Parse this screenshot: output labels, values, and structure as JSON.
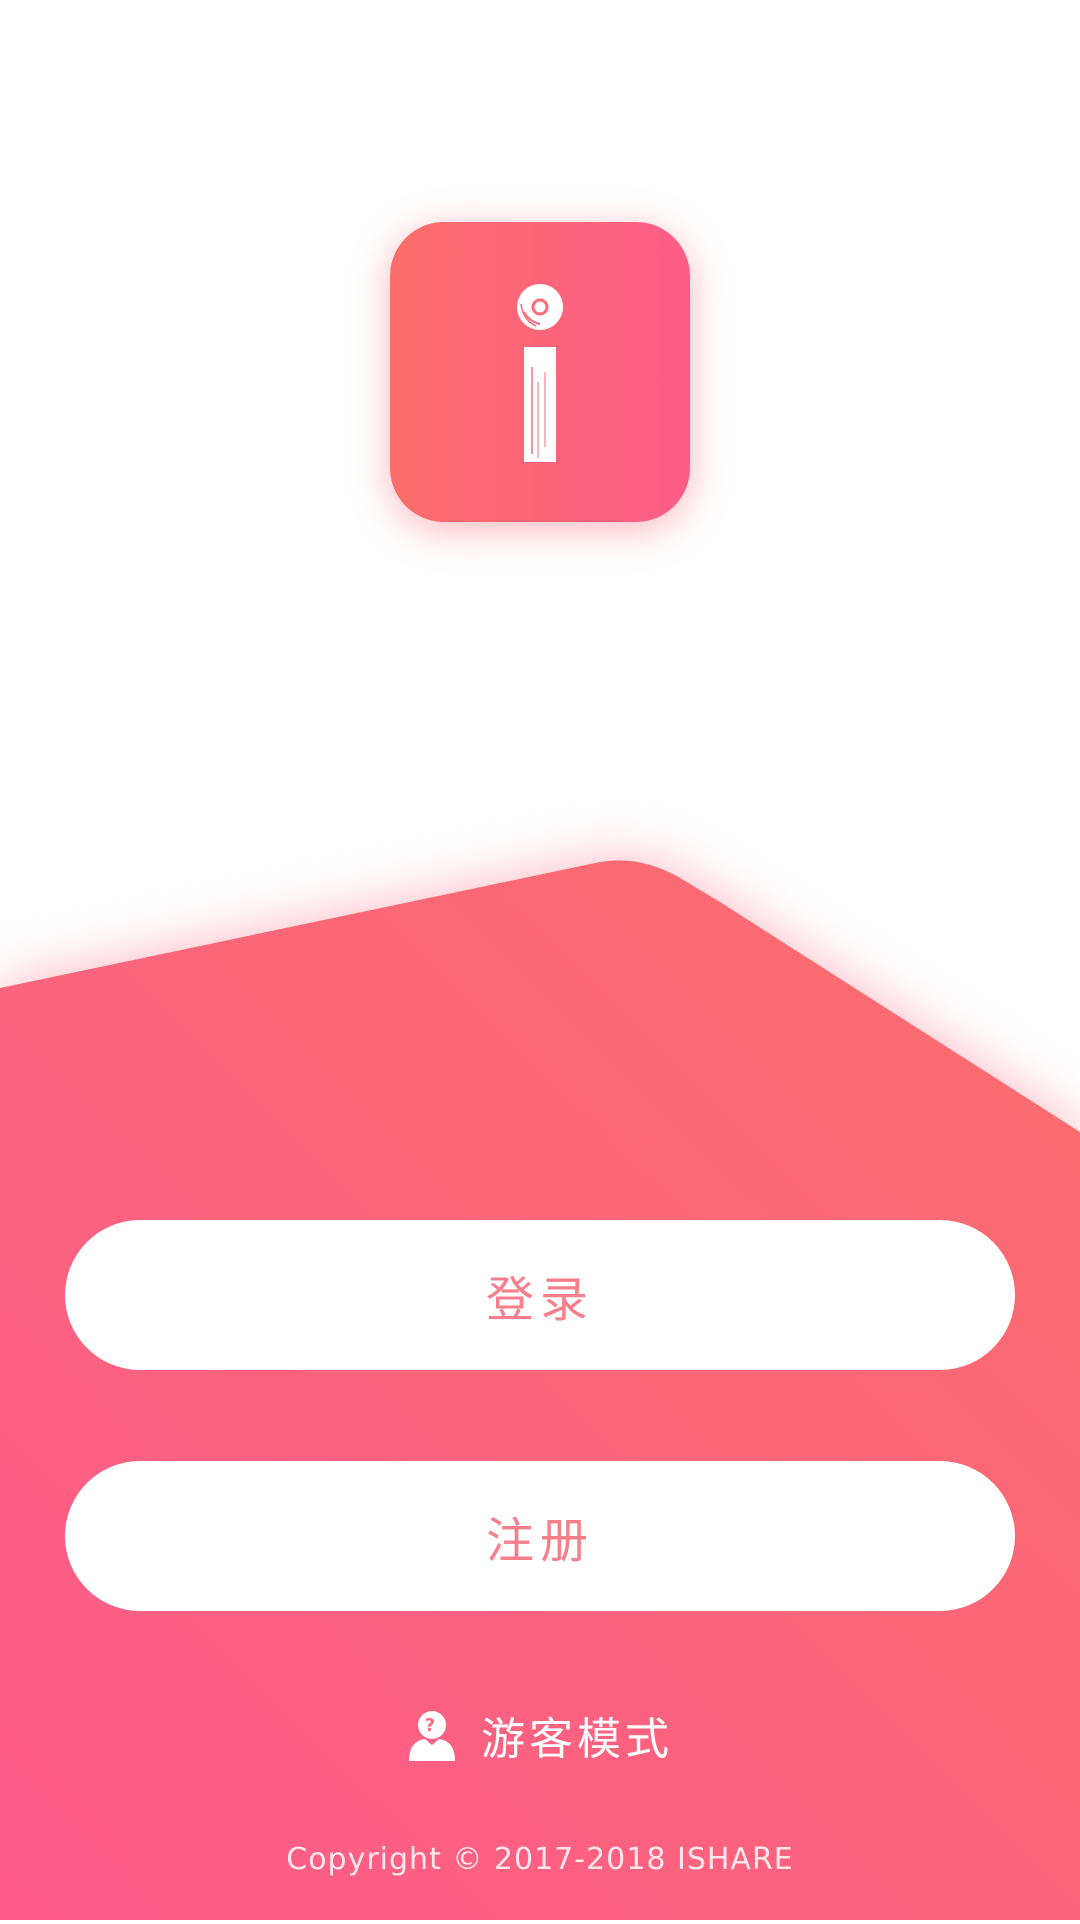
{
  "colors": {
    "brand_start": "#fb6d6b",
    "brand_end": "#fe5d87",
    "button_text": "#f77f8b"
  },
  "logo": {
    "icon": "ishare-i-logo-icon"
  },
  "actions": {
    "login_label": "登录",
    "register_label": "注册",
    "guest_label": "游客模式",
    "guest_icon": "guest-user-icon"
  },
  "footer": {
    "copyright": "Copyright © 2017-2018 ISHARE"
  }
}
